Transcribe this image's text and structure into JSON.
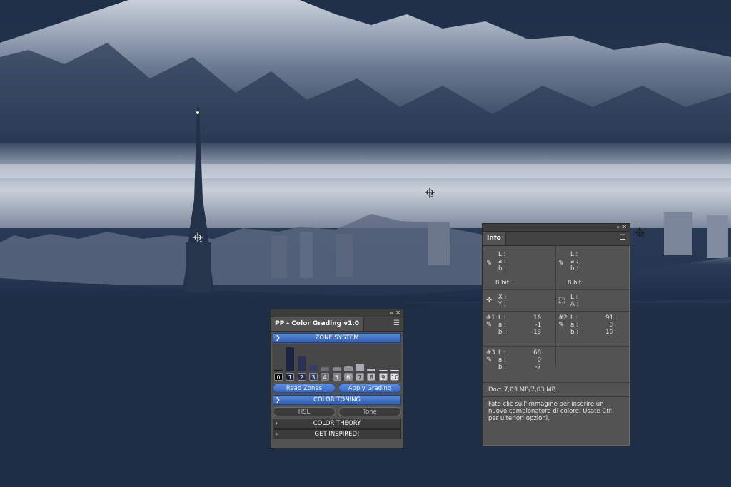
{
  "color_grading": {
    "title": "PP - Color Grading v1.0",
    "sections": {
      "zone_system": "ZONE SYSTEM",
      "color_toning": "COLOR TONING",
      "color_theory": "COLOR THEORY",
      "get_inspired": "GET INSPIRED!"
    },
    "zones": [
      "0",
      "1",
      "2",
      "3",
      "4",
      "5",
      "6",
      "7",
      "8",
      "9",
      "10"
    ],
    "zone_levels": [
      0.05,
      0.95,
      0.6,
      0.25,
      0.18,
      0.18,
      0.2,
      0.3,
      0.12,
      0.06,
      0.06
    ],
    "buttons": {
      "read_zones": "Read Zones",
      "apply_grading": "Apply Grading",
      "hsl": "HSL",
      "tone": "Tone"
    }
  },
  "info": {
    "tab": "Info",
    "lab_labels": [
      "L :",
      "a :",
      "b :"
    ],
    "bits_left": "8 bit",
    "bits_right": "8 bit",
    "xy_labels": [
      "X :",
      "Y :"
    ],
    "la_labels": [
      "L :",
      "A :"
    ],
    "sampler1": {
      "id": "#1",
      "L": "16",
      "a": "-1",
      "b": "-13"
    },
    "sampler2": {
      "id": "#2",
      "L": "91",
      "a": "3",
      "b": "10"
    },
    "sampler3": {
      "id": "#3",
      "L": "68",
      "a": "0",
      "b": "-7"
    },
    "doc": "Doc: 7,03 MB/7,03 MB",
    "hint": "Fate clic sull'immagine per inserire un nuovo campionatore di colore. Usate Ctrl per ulteriori opzioni."
  },
  "samplers_on_canvas": [
    "1",
    "2",
    "3"
  ],
  "colors": {
    "accent": "#3f6fc8",
    "panel": "#535353",
    "sky": "#1e2d45"
  }
}
